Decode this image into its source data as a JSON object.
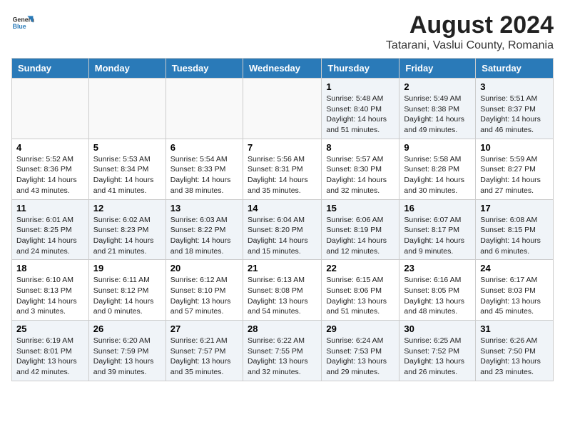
{
  "header": {
    "logo_general": "General",
    "logo_blue": "Blue",
    "title": "August 2024",
    "subtitle": "Tatarani, Vaslui County, Romania"
  },
  "days_of_week": [
    "Sunday",
    "Monday",
    "Tuesday",
    "Wednesday",
    "Thursday",
    "Friday",
    "Saturday"
  ],
  "weeks": [
    [
      {
        "day": "",
        "info": ""
      },
      {
        "day": "",
        "info": ""
      },
      {
        "day": "",
        "info": ""
      },
      {
        "day": "",
        "info": ""
      },
      {
        "day": "1",
        "info": "Sunrise: 5:48 AM\nSunset: 8:40 PM\nDaylight: 14 hours and 51 minutes."
      },
      {
        "day": "2",
        "info": "Sunrise: 5:49 AM\nSunset: 8:38 PM\nDaylight: 14 hours and 49 minutes."
      },
      {
        "day": "3",
        "info": "Sunrise: 5:51 AM\nSunset: 8:37 PM\nDaylight: 14 hours and 46 minutes."
      }
    ],
    [
      {
        "day": "4",
        "info": "Sunrise: 5:52 AM\nSunset: 8:36 PM\nDaylight: 14 hours and 43 minutes."
      },
      {
        "day": "5",
        "info": "Sunrise: 5:53 AM\nSunset: 8:34 PM\nDaylight: 14 hours and 41 minutes."
      },
      {
        "day": "6",
        "info": "Sunrise: 5:54 AM\nSunset: 8:33 PM\nDaylight: 14 hours and 38 minutes."
      },
      {
        "day": "7",
        "info": "Sunrise: 5:56 AM\nSunset: 8:31 PM\nDaylight: 14 hours and 35 minutes."
      },
      {
        "day": "8",
        "info": "Sunrise: 5:57 AM\nSunset: 8:30 PM\nDaylight: 14 hours and 32 minutes."
      },
      {
        "day": "9",
        "info": "Sunrise: 5:58 AM\nSunset: 8:28 PM\nDaylight: 14 hours and 30 minutes."
      },
      {
        "day": "10",
        "info": "Sunrise: 5:59 AM\nSunset: 8:27 PM\nDaylight: 14 hours and 27 minutes."
      }
    ],
    [
      {
        "day": "11",
        "info": "Sunrise: 6:01 AM\nSunset: 8:25 PM\nDaylight: 14 hours and 24 minutes."
      },
      {
        "day": "12",
        "info": "Sunrise: 6:02 AM\nSunset: 8:23 PM\nDaylight: 14 hours and 21 minutes."
      },
      {
        "day": "13",
        "info": "Sunrise: 6:03 AM\nSunset: 8:22 PM\nDaylight: 14 hours and 18 minutes."
      },
      {
        "day": "14",
        "info": "Sunrise: 6:04 AM\nSunset: 8:20 PM\nDaylight: 14 hours and 15 minutes."
      },
      {
        "day": "15",
        "info": "Sunrise: 6:06 AM\nSunset: 8:19 PM\nDaylight: 14 hours and 12 minutes."
      },
      {
        "day": "16",
        "info": "Sunrise: 6:07 AM\nSunset: 8:17 PM\nDaylight: 14 hours and 9 minutes."
      },
      {
        "day": "17",
        "info": "Sunrise: 6:08 AM\nSunset: 8:15 PM\nDaylight: 14 hours and 6 minutes."
      }
    ],
    [
      {
        "day": "18",
        "info": "Sunrise: 6:10 AM\nSunset: 8:13 PM\nDaylight: 14 hours and 3 minutes."
      },
      {
        "day": "19",
        "info": "Sunrise: 6:11 AM\nSunset: 8:12 PM\nDaylight: 14 hours and 0 minutes."
      },
      {
        "day": "20",
        "info": "Sunrise: 6:12 AM\nSunset: 8:10 PM\nDaylight: 13 hours and 57 minutes."
      },
      {
        "day": "21",
        "info": "Sunrise: 6:13 AM\nSunset: 8:08 PM\nDaylight: 13 hours and 54 minutes."
      },
      {
        "day": "22",
        "info": "Sunrise: 6:15 AM\nSunset: 8:06 PM\nDaylight: 13 hours and 51 minutes."
      },
      {
        "day": "23",
        "info": "Sunrise: 6:16 AM\nSunset: 8:05 PM\nDaylight: 13 hours and 48 minutes."
      },
      {
        "day": "24",
        "info": "Sunrise: 6:17 AM\nSunset: 8:03 PM\nDaylight: 13 hours and 45 minutes."
      }
    ],
    [
      {
        "day": "25",
        "info": "Sunrise: 6:19 AM\nSunset: 8:01 PM\nDaylight: 13 hours and 42 minutes."
      },
      {
        "day": "26",
        "info": "Sunrise: 6:20 AM\nSunset: 7:59 PM\nDaylight: 13 hours and 39 minutes."
      },
      {
        "day": "27",
        "info": "Sunrise: 6:21 AM\nSunset: 7:57 PM\nDaylight: 13 hours and 35 minutes."
      },
      {
        "day": "28",
        "info": "Sunrise: 6:22 AM\nSunset: 7:55 PM\nDaylight: 13 hours and 32 minutes."
      },
      {
        "day": "29",
        "info": "Sunrise: 6:24 AM\nSunset: 7:53 PM\nDaylight: 13 hours and 29 minutes."
      },
      {
        "day": "30",
        "info": "Sunrise: 6:25 AM\nSunset: 7:52 PM\nDaylight: 13 hours and 26 minutes."
      },
      {
        "day": "31",
        "info": "Sunrise: 6:26 AM\nSunset: 7:50 PM\nDaylight: 13 hours and 23 minutes."
      }
    ]
  ]
}
